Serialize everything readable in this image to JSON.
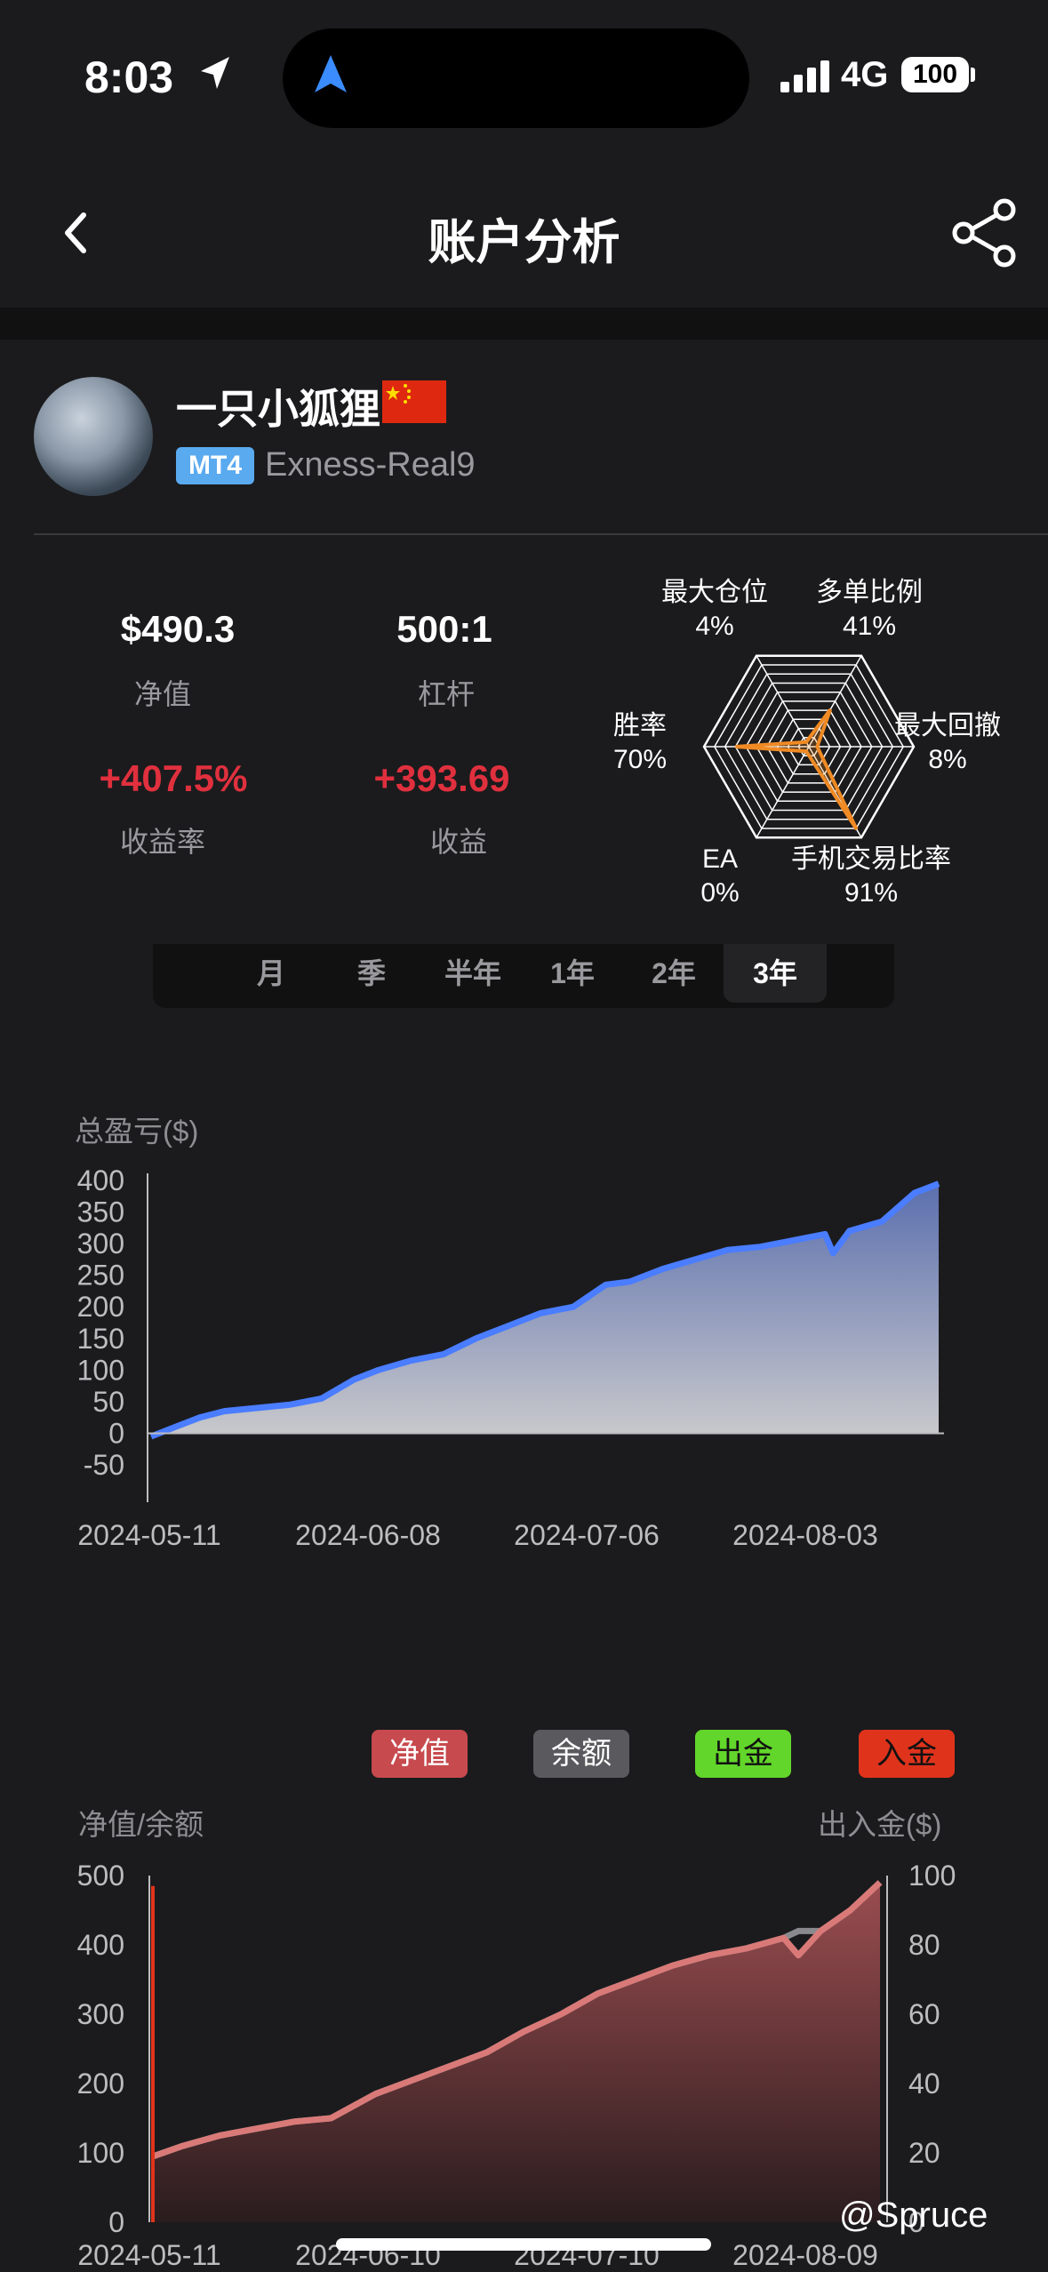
{
  "status_bar": {
    "time": "8:03",
    "network": "4G",
    "battery": "100"
  },
  "header": {
    "title": "账户分析"
  },
  "profile": {
    "name": "一只小狐狸",
    "platform": "MT4",
    "server": "Exness-Real9"
  },
  "stats": {
    "equity": {
      "value": "$490.3",
      "label": "净值"
    },
    "leverage": {
      "value": "500:1",
      "label": "杠杆"
    },
    "return_rate": {
      "value": "+407.5%",
      "label": "收益率"
    },
    "profit": {
      "value": "+393.69",
      "label": "收益"
    }
  },
  "radar": {
    "axes": [
      {
        "name": "最大仓位",
        "value": "4%",
        "level": 0.04
      },
      {
        "name": "多单比例",
        "value": "41%",
        "level": 0.41
      },
      {
        "name": "最大回撤",
        "value": "8%",
        "level": 0.08
      },
      {
        "name": "手机交易比率",
        "value": "91%",
        "level": 0.91
      },
      {
        "name": "EA",
        "value": "0%",
        "level": 0.0
      },
      {
        "name": "胜率",
        "value": "70%",
        "level": 0.7
      }
    ],
    "color": "#f08a24"
  },
  "periods": [
    "月",
    "季",
    "半年",
    "1年",
    "2年",
    "3年"
  ],
  "active_period": "3年",
  "chart_data": [
    {
      "type": "area",
      "title": "总盈亏($)",
      "ylim": [
        -50,
        400
      ],
      "y_ticks": [
        "400",
        "350",
        "300",
        "250",
        "200",
        "150",
        "100",
        "50",
        "0",
        "-50"
      ],
      "x_ticks": [
        "2024-05-11",
        "2024-06-08",
        "2024-07-06",
        "2024-08-03"
      ],
      "x": [
        "2024-05-11",
        "2024-05-14",
        "2024-05-17",
        "2024-05-20",
        "2024-05-24",
        "2024-05-28",
        "2024-06-01",
        "2024-06-05",
        "2024-06-08",
        "2024-06-12",
        "2024-06-16",
        "2024-06-20",
        "2024-06-24",
        "2024-06-28",
        "2024-07-02",
        "2024-07-06",
        "2024-07-09",
        "2024-07-13",
        "2024-07-17",
        "2024-07-21",
        "2024-07-25",
        "2024-07-29",
        "2024-08-02",
        "2024-08-03",
        "2024-08-05",
        "2024-08-09",
        "2024-08-13",
        "2024-08-16"
      ],
      "values": [
        -5,
        10,
        25,
        35,
        40,
        45,
        55,
        85,
        100,
        115,
        125,
        150,
        170,
        190,
        200,
        235,
        240,
        260,
        275,
        290,
        295,
        305,
        315,
        285,
        320,
        335,
        380,
        395
      ],
      "color": "#4a7dff"
    },
    {
      "type": "area",
      "title": "净值/余额",
      "right_title": "出入金($)",
      "legend": [
        {
          "name": "净值",
          "color": "#c74a4e"
        },
        {
          "name": "余额",
          "color": "#5a5a5e"
        },
        {
          "name": "出金",
          "color": "#62d62a"
        },
        {
          "name": "入金",
          "color": "#e0331c"
        }
      ],
      "ylim": [
        0,
        500
      ],
      "y_ticks": [
        "500",
        "400",
        "300",
        "200",
        "100",
        "0"
      ],
      "y2lim": [
        0,
        100
      ],
      "y2_ticks": [
        "100",
        "80",
        "60",
        "40",
        "20",
        "0"
      ],
      "x_ticks": [
        "2024-05-11",
        "2024-06-10",
        "2024-07-10",
        "2024-08-09"
      ],
      "x": [
        "2024-05-11",
        "2024-05-15",
        "2024-05-20",
        "2024-05-25",
        "2024-05-30",
        "2024-06-04",
        "2024-06-10",
        "2024-06-15",
        "2024-06-20",
        "2024-06-25",
        "2024-06-30",
        "2024-07-05",
        "2024-07-10",
        "2024-07-15",
        "2024-07-20",
        "2024-07-25",
        "2024-07-30",
        "2024-08-04",
        "2024-08-06",
        "2024-08-09",
        "2024-08-13",
        "2024-08-17"
      ],
      "equity": [
        95,
        110,
        125,
        135,
        145,
        150,
        185,
        205,
        225,
        245,
        275,
        300,
        330,
        350,
        370,
        385,
        395,
        410,
        385,
        420,
        450,
        490
      ],
      "balance": [
        95,
        110,
        125,
        135,
        145,
        150,
        185,
        205,
        225,
        245,
        275,
        300,
        330,
        350,
        370,
        385,
        395,
        410,
        420,
        420,
        450,
        490
      ],
      "deposits": [
        {
          "x": "2024-05-11",
          "value": 97
        }
      ],
      "color": "#c47070"
    }
  ],
  "watermark": "@Spruce"
}
